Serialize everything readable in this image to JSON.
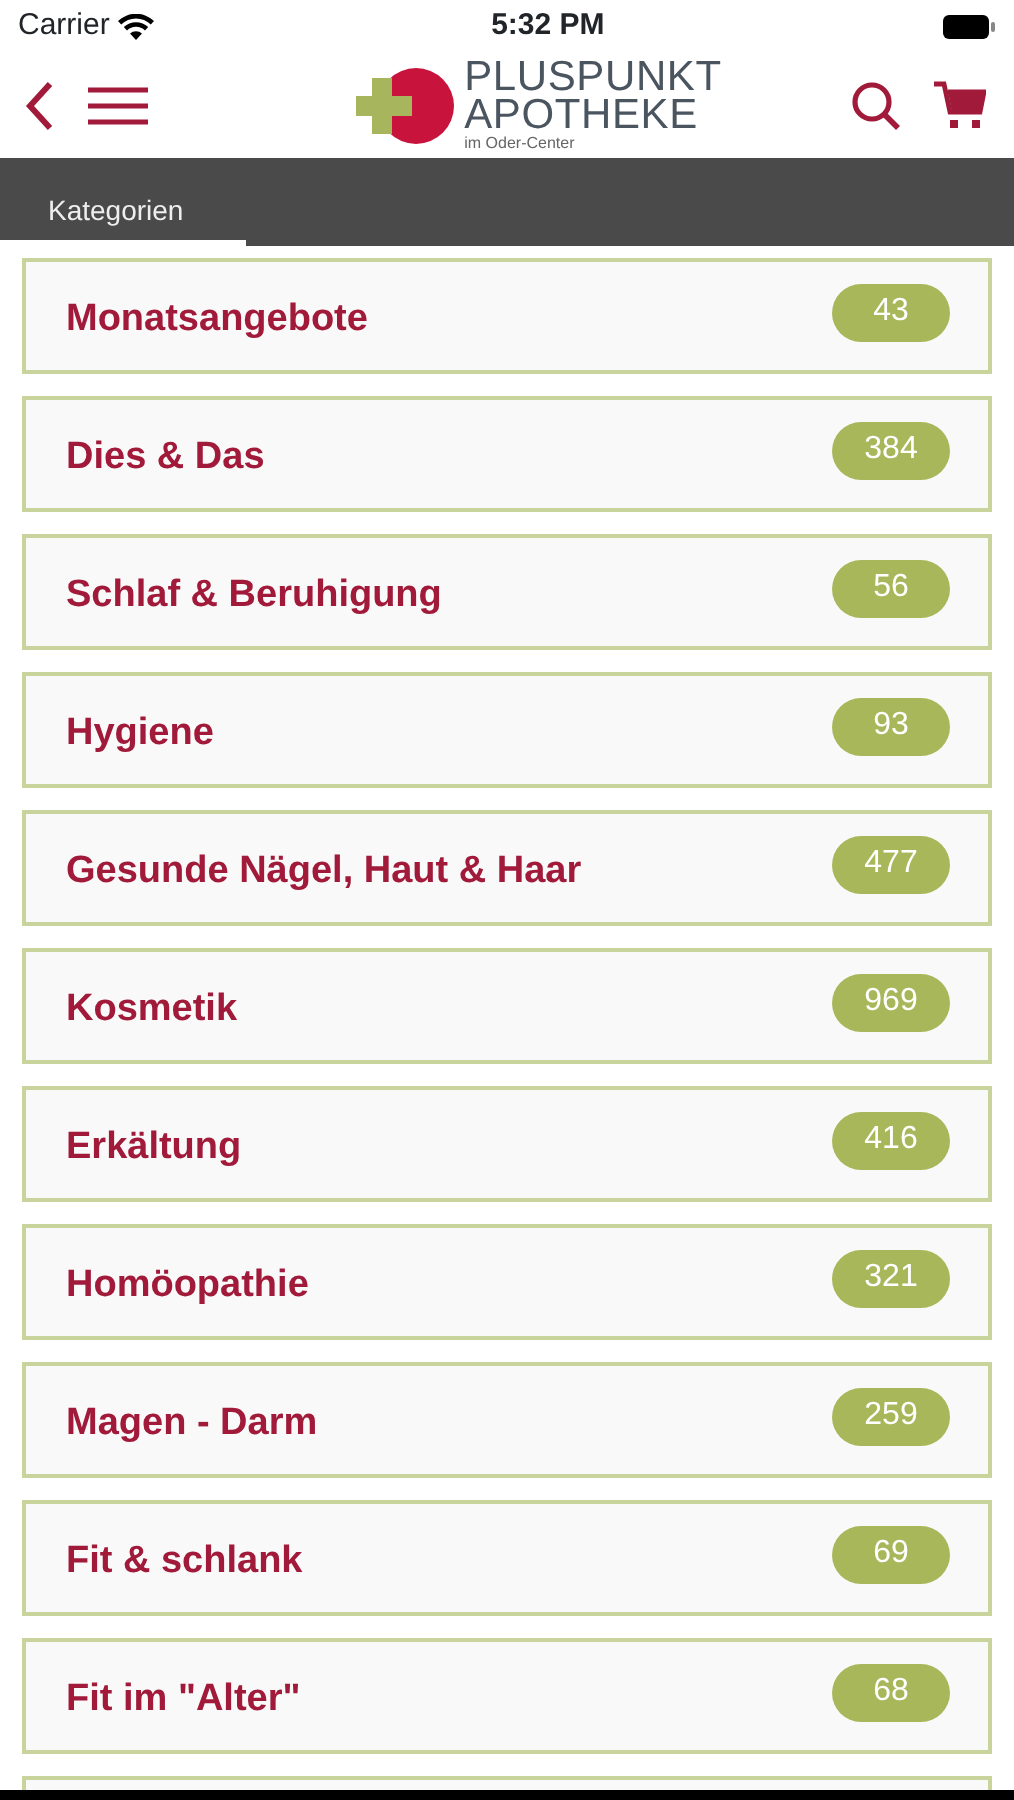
{
  "status_bar": {
    "carrier": "Carrier",
    "time": "5:32 PM"
  },
  "logo": {
    "line_1": "PLUSPUNKT",
    "line_2": "APOTHEKE",
    "line_3": "im Oder-Center"
  },
  "tabs": [
    {
      "label": "Kategorien",
      "selected": true
    }
  ],
  "categories": [
    {
      "name": "Monatsangebote",
      "count": "43"
    },
    {
      "name": "Dies & Das",
      "count": "384"
    },
    {
      "name": "Schlaf & Beruhigung",
      "count": "56"
    },
    {
      "name": "Hygiene",
      "count": "93"
    },
    {
      "name": "Gesunde Nägel, Haut & Haar",
      "count": "477"
    },
    {
      "name": "Kosmetik",
      "count": "969"
    },
    {
      "name": "Erkältung",
      "count": "416"
    },
    {
      "name": "Homöopathie",
      "count": "321"
    },
    {
      "name": "Magen - Darm",
      "count": "259"
    },
    {
      "name": "Fit & schlank",
      "count": "69"
    },
    {
      "name": "Fit im \"Alter\"",
      "count": "68"
    }
  ]
}
